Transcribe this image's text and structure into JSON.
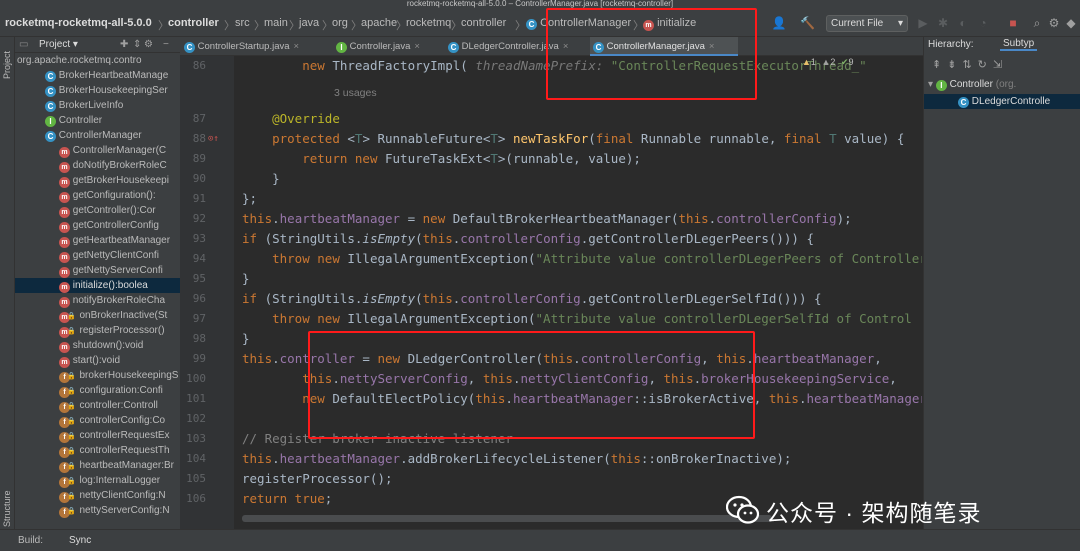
{
  "window": {
    "title": "rocketmq-rocketmq-all-5.0.0 – ControllerManager.java [rocketmq-controller]"
  },
  "breadcrumbs": {
    "items": [
      "rocketmq-rocketmq-all-5.0.0",
      "controller",
      "src",
      "main",
      "java",
      "org",
      "apache",
      "rocketmq",
      "controller",
      "ControllerManager",
      "initialize"
    ],
    "separator": "〉"
  },
  "toolbar": {
    "run_config": "Current File",
    "run_config_arrow": "▾"
  },
  "project_panel": {
    "title": "Project",
    "title_arrow": "▾",
    "side_tab": "Project",
    "structure_tab": "Structure",
    "items": [
      {
        "icon": "",
        "label": "org.apache.rocketmq.contro",
        "indent": 2,
        "lock": false
      },
      {
        "icon": "C",
        "label": "BrokerHeartbeatManage",
        "indent": 30,
        "lock": false
      },
      {
        "icon": "C",
        "label": "BrokerHousekeepingSer",
        "indent": 30,
        "lock": false
      },
      {
        "icon": "C",
        "label": "BrokerLiveInfo",
        "indent": 30,
        "lock": false
      },
      {
        "icon": "I",
        "label": "Controller",
        "indent": 30,
        "lock": false
      },
      {
        "icon": "C",
        "label": "ControllerManager",
        "indent": 30,
        "lock": false
      },
      {
        "icon": "m",
        "label": "ControllerManager(C",
        "indent": 44,
        "lock": false
      },
      {
        "icon": "m",
        "label": "doNotifyBrokerRoleC",
        "indent": 44,
        "lock": false
      },
      {
        "icon": "m",
        "label": "getBrokerHousekeepi",
        "indent": 44,
        "lock": false
      },
      {
        "icon": "m",
        "label": "getConfiguration():",
        "indent": 44,
        "lock": false
      },
      {
        "icon": "m",
        "label": "getController():Cor",
        "indent": 44,
        "lock": false
      },
      {
        "icon": "m",
        "label": "getControllerConfig",
        "indent": 44,
        "lock": false
      },
      {
        "icon": "m",
        "label": "getHeartbeatManager",
        "indent": 44,
        "lock": false
      },
      {
        "icon": "m",
        "label": "getNettyClientConfi",
        "indent": 44,
        "lock": false
      },
      {
        "icon": "m",
        "label": "getNettyServerConfi",
        "indent": 44,
        "lock": false
      },
      {
        "icon": "m",
        "label": "initialize():boolea",
        "indent": 44,
        "lock": false,
        "selected": true
      },
      {
        "icon": "m",
        "label": "notifyBrokerRoleCha",
        "indent": 44,
        "lock": false
      },
      {
        "icon": "m",
        "label": "onBrokerInactive(St",
        "indent": 44,
        "lock": true
      },
      {
        "icon": "m",
        "label": "registerProcessor()",
        "indent": 44,
        "lock": true
      },
      {
        "icon": "m",
        "label": "shutdown():void",
        "indent": 44,
        "lock": false
      },
      {
        "icon": "m",
        "label": "start():void",
        "indent": 44,
        "lock": false
      },
      {
        "icon": "f",
        "label": "brokerHousekeepingS",
        "indent": 44,
        "lock": true
      },
      {
        "icon": "f",
        "label": "configuration:Confi",
        "indent": 44,
        "lock": true
      },
      {
        "icon": "f",
        "label": "controller:Controll",
        "indent": 44,
        "lock": true
      },
      {
        "icon": "f",
        "label": "controllerConfig:Co",
        "indent": 44,
        "lock": true
      },
      {
        "icon": "f",
        "label": "controllerRequestEx",
        "indent": 44,
        "lock": true
      },
      {
        "icon": "f",
        "label": "controllerRequestTh",
        "indent": 44,
        "lock": true
      },
      {
        "icon": "f",
        "label": "heartbeatManager:Br",
        "indent": 44,
        "lock": true
      },
      {
        "icon": "f",
        "label": "log:InternalLogger",
        "indent": 44,
        "lock": true
      },
      {
        "icon": "f",
        "label": "nettyClientConfig:N",
        "indent": 44,
        "lock": true
      },
      {
        "icon": "f",
        "label": "nettyServerConfig:N",
        "indent": 44,
        "lock": true
      }
    ]
  },
  "editor": {
    "tabs": [
      {
        "label": "ControllerStartup.java",
        "active": false
      },
      {
        "label": "Controller.java",
        "active": false
      },
      {
        "label": "DLedgerController.java",
        "active": false
      },
      {
        "label": "ControllerManager.java",
        "active": true
      }
    ],
    "close_glyph": "×",
    "warnings": {
      "warn_count": "1",
      "weak_count": "2",
      "info_count": "9"
    },
    "lines": [
      {
        "num": "86",
        "html": "        <span class='kw'>new</span> ThreadFactoryImpl( <span class='ph it'>threadNamePrefix:</span> <span class='str'>\"ControllerRequestExecutorThread_\"</span>"
      },
      {
        "num": "",
        "hint": "3 usages",
        "html": ""
      },
      {
        "num": "87",
        "html": "    <span class='an'>@Override</span>"
      },
      {
        "num": "88",
        "html": "    <span class='kw'>protected</span> &lt;<span class='tp'>T</span>&gt; RunnableFuture&lt;<span class='tp'>T</span>&gt; <span class='fn'>newTaskFor</span>(<span class='kw'>final</span> Runnable runnable, <span class='kw'>final</span> <span class='tp'>T</span> value) {"
      },
      {
        "num": "89",
        "html": "        <span class='kw'>return new</span> FutureTaskExt&lt;<span class='tp'>T</span>&gt;(runnable, value);"
      },
      {
        "num": "90",
        "html": "    }"
      },
      {
        "num": "91",
        "html": "};"
      },
      {
        "num": "92",
        "html": "<span class='kw'>this</span>.<span class='fd'>heartbeatManager</span> = <span class='kw'>new</span> DefaultBrokerHeartbeatManager(<span class='kw'>this</span>.<span class='fd'>controllerConfig</span>);"
      },
      {
        "num": "93",
        "html": "<span class='kw'>if</span> (StringUtils.<span class='it'>isEmpty</span>(<span class='kw'>this</span>.<span class='fd'>controllerConfig</span>.getControllerDLegerPeers())) {"
      },
      {
        "num": "94",
        "html": "    <span class='kw'>throw new</span> IllegalArgumentException(<span class='str'>\"Attribute value controllerDLegerPeers of Controller</span>"
      },
      {
        "num": "95",
        "html": "}"
      },
      {
        "num": "96",
        "html": "<span class='kw'>if</span> (StringUtils.<span class='it'>isEmpty</span>(<span class='kw'>this</span>.<span class='fd'>controllerConfig</span>.getControllerDLegerSelfId())) {"
      },
      {
        "num": "97",
        "html": "    <span class='kw'>throw new</span> IllegalArgumentException(<span class='str'>\"Attribute value controllerDLegerSelfId of Control</span>"
      },
      {
        "num": "98",
        "html": "}"
      },
      {
        "num": "99",
        "html": "<span class='kw'>this</span>.<span class='fd'>controller</span> = <span class='kw'>new</span> DLedgerController(<span class='kw'>this</span>.<span class='fd'>controllerConfig</span>, <span class='kw'>this</span>.<span class='fd'>heartbeatManager</span>,"
      },
      {
        "num": "100",
        "html": "        <span class='kw'>this</span>.<span class='fd'>nettyServerConfig</span>, <span class='kw'>this</span>.<span class='fd'>nettyClientConfig</span>, <span class='kw'>this</span>.<span class='fd'>brokerHousekeepingService</span>,"
      },
      {
        "num": "101",
        "html": "        <span class='kw'>new</span> DefaultElectPolicy(<span class='kw'>this</span>.<span class='fd'>heartbeatManager</span>::isBrokerActive, <span class='kw'>this</span>.<span class='fd'>heartbeatManager</span>::"
      },
      {
        "num": "102",
        "html": ""
      },
      {
        "num": "103",
        "html": "<span class='cm'>// Register broker inactive listener</span>"
      },
      {
        "num": "104",
        "html": "<span class='kw'>this</span>.<span class='fd'>heartbeatManager</span>.addBrokerLifecycleListener(<span class='kw'>this</span>::onBrokerInactive);"
      },
      {
        "num": "105",
        "html": "registerProcessor();"
      },
      {
        "num": "106",
        "html": "<span class='kw'>return true</span>;"
      }
    ]
  },
  "hierarchy_panel": {
    "title": "Hierarchy:",
    "tab": "Subtyp",
    "root": {
      "label": "Controller",
      "suffix": "(org."
    },
    "child": {
      "label": "DLedgerControlle"
    }
  },
  "bottom_bar": {
    "build_label": "Build:",
    "sync_label": "Sync"
  },
  "watermark": {
    "text": "公众号 · 架构随笔录"
  },
  "colors": {
    "highlight_box": "#ff1a1a",
    "keyword": "#cc7832",
    "field": "#9876aa",
    "string": "#6a8759",
    "annotation": "#bbb529"
  }
}
